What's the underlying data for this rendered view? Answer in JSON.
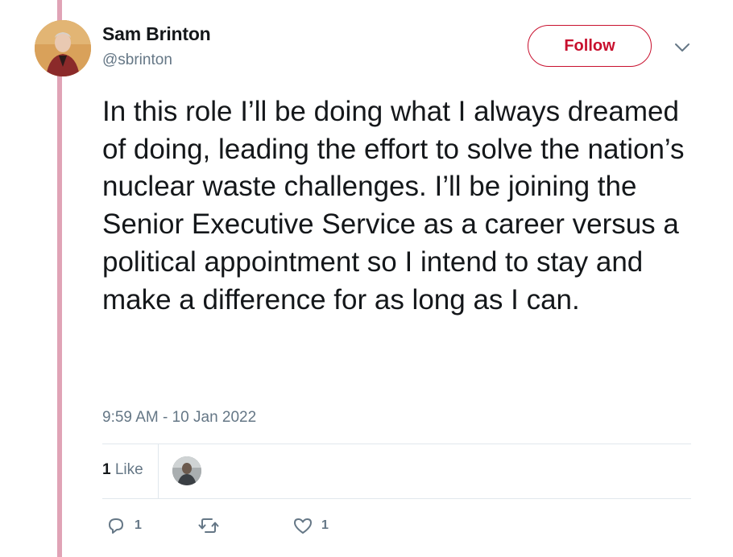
{
  "author": {
    "display_name": "Sam Brinton",
    "handle": "@sbrinton"
  },
  "follow_button": {
    "label": "Follow"
  },
  "tweet": {
    "text": "In this role I’ll be doing what I always dreamed of doing, leading the effort to solve the nation’s nuclear waste challenges. I’ll be joining the Senior Executive Service as a career versus a political appointment so I intend to stay and make a difference for as long as I can.",
    "timestamp": "9:59 AM - 10 Jan 2022"
  },
  "stats": {
    "like_count": "1",
    "like_label": "Like"
  },
  "actions": {
    "reply_count": "1",
    "like_count": "1"
  },
  "colors": {
    "accent": "#c8102e",
    "thread_line": "#e0a3b6",
    "secondary_text": "#657786"
  },
  "icons": {
    "reply": "reply-icon",
    "retweet": "retweet-icon",
    "like": "heart-icon",
    "menu": "chevron-down-icon"
  }
}
